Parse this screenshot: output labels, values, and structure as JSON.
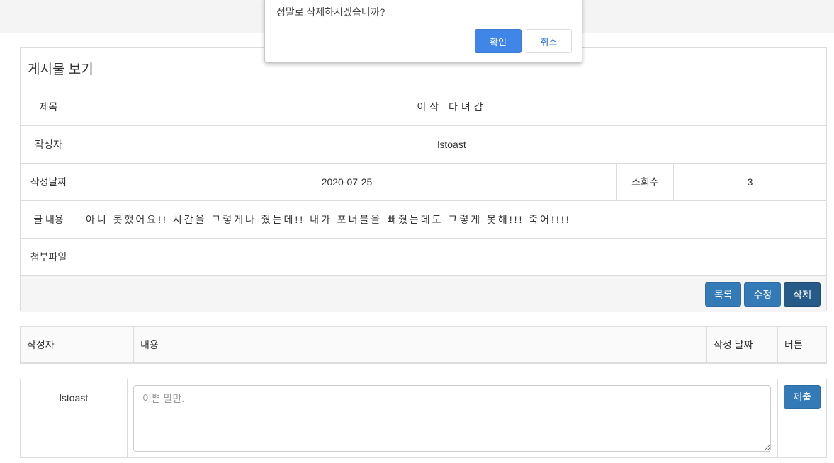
{
  "post": {
    "header": "게시물 보기",
    "title_label": "제목",
    "title": "이삭 다녀감",
    "author_label": "작성자",
    "author": "lstoast",
    "date_label": "작성날짜",
    "date": "2020-07-25",
    "views_label": "조회수",
    "views": "3",
    "content_label": "글 내용",
    "content": "아니  못했어요!! 시간을 그렇게나 줬는데!! 내가 포너블을 빼줬는데도 그렇게 못해!!! 죽어!!!!",
    "attachment_label": "첨부파일",
    "attachment": "",
    "buttons": {
      "list": "목록",
      "edit": "수정",
      "delete": "삭제"
    }
  },
  "comments": {
    "headers": [
      "작성자",
      "내용",
      "작성 날짜",
      "버튼"
    ],
    "form": {
      "author": "lstoast",
      "placeholder": "이쁜 말만.",
      "submit": "제출"
    }
  },
  "dialog": {
    "message": "정말로 삭제하시겠습니까?",
    "ok": "확인",
    "cancel": "취소"
  },
  "colors": {
    "primary": "#337ab7",
    "primary_active": "#265a88",
    "dialog_ok": "#3f86e8",
    "border": "#dcdcdc"
  }
}
